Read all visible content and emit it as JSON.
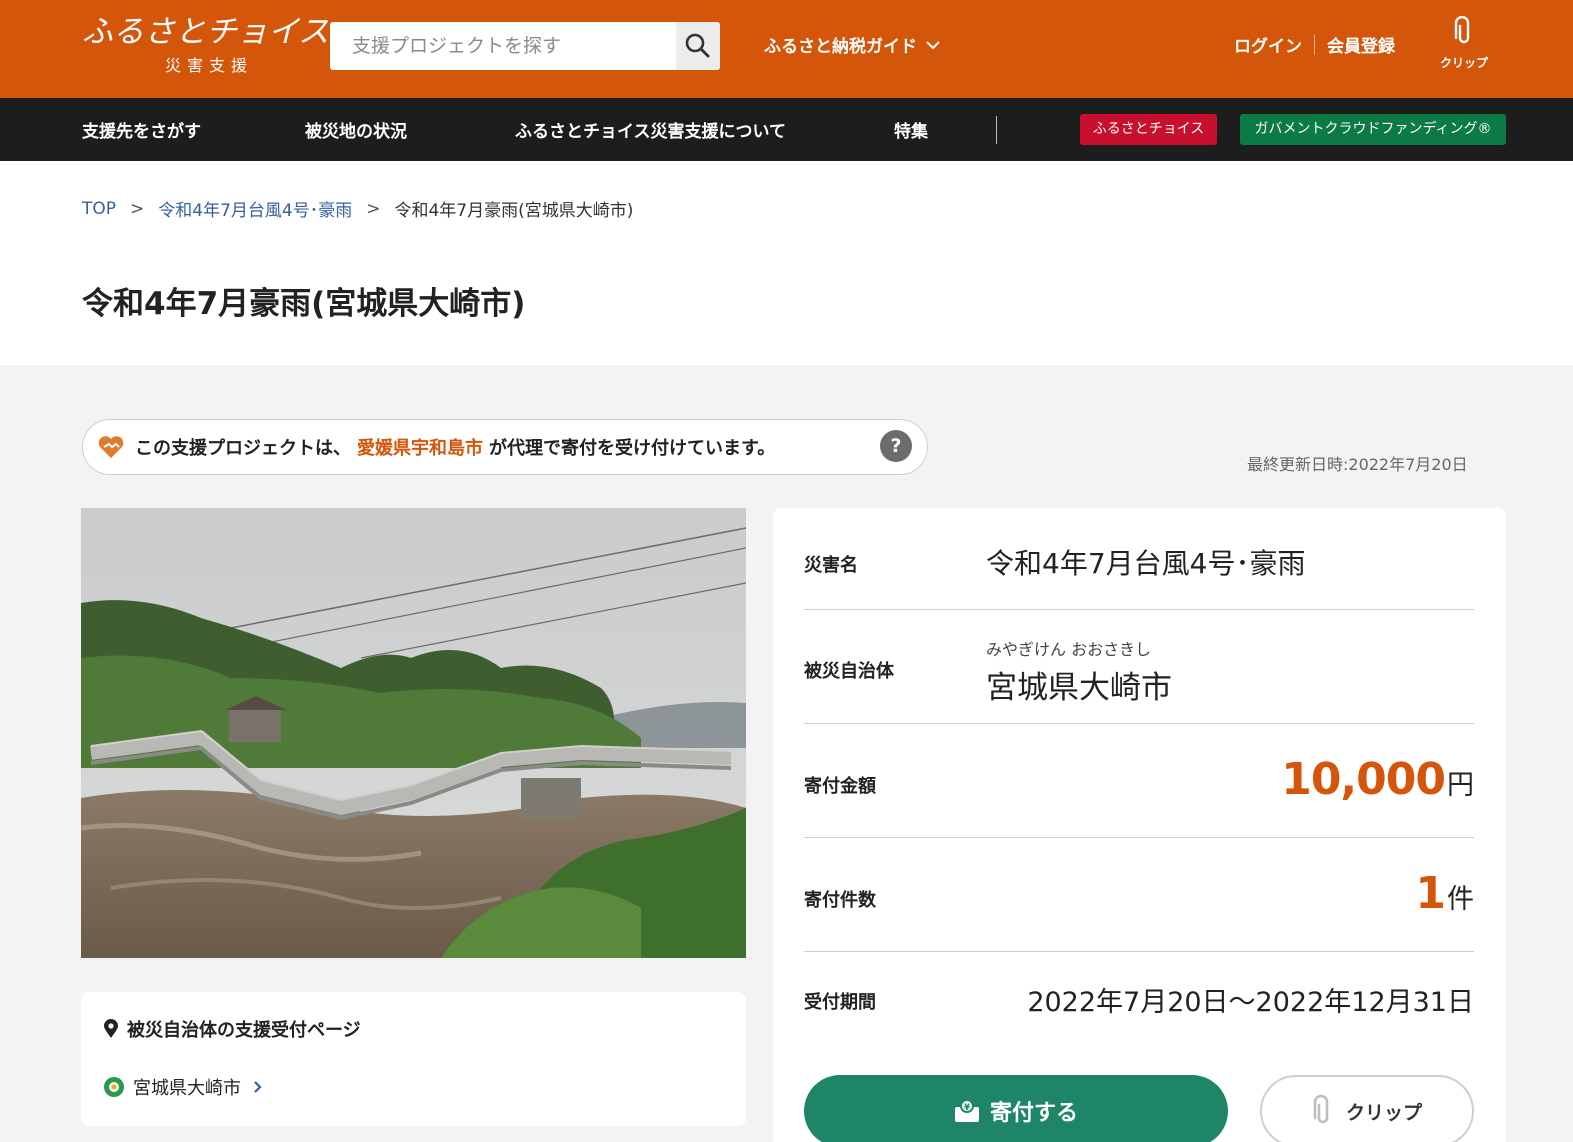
{
  "header": {
    "logo_main": "ふるさとチョイス",
    "logo_sub": "災害支援",
    "search_placeholder": "支援プロジェクトを探す",
    "guide_label": "ふるさと納税ガイド",
    "login_label": "ログイン",
    "register_label": "会員登録",
    "clip_label": "クリップ",
    "brand_color": "#d4560a"
  },
  "nav": {
    "items": [
      "支援先をさがす",
      "被災地の状況",
      "ふるさとチョイス災害支援について",
      "特集"
    ],
    "red_button": "ふるさとチョイス",
    "green_button": "ガバメントクラウドファンディング®"
  },
  "breadcrumb": {
    "top": "TOP",
    "sep": ">",
    "parent": "令和4年7月台風4号･豪雨",
    "current": "令和4年7月豪雨(宮城県大崎市)"
  },
  "page_title": "令和4年7月豪雨(宮城県大崎市)",
  "notice": {
    "prefix": "この支援プロジェクトは、",
    "municipality": "愛媛県宇和島市",
    "suffix": "が代理で寄付を受け付けています。",
    "help_icon": "?"
  },
  "last_updated": "最終更新日時:2022年7月20日",
  "details": {
    "disaster_label": "災害名",
    "disaster_value": "令和4年7月台風4号･豪雨",
    "municipality_label": "被災自治体",
    "municipality_ruby": "みやぎけん おおさきし",
    "municipality_value": "宮城県大崎市",
    "amount_label": "寄付金額",
    "amount_value": "10,000",
    "amount_unit": "円",
    "count_label": "寄付件数",
    "count_value": "1",
    "count_unit": "件",
    "period_label": "受付期間",
    "period_value": "2022年7月20日～2022年12月31日"
  },
  "actions": {
    "donate_label": "寄付する",
    "clip_label": "クリップ"
  },
  "municipality_card": {
    "title": "被災自治体の支援受付ページ",
    "link_label": "宮城県大崎市"
  }
}
